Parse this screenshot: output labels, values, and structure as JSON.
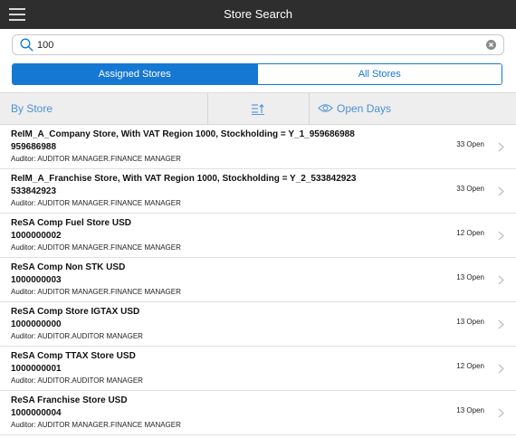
{
  "header": {
    "title": "Store Search",
    "menu_icon": "hamburger-menu-icon"
  },
  "search": {
    "value": "100",
    "placeholder": "",
    "search_icon": "search-icon",
    "clear_icon": "clear-icon"
  },
  "segments": [
    {
      "label": "Assigned Stores",
      "selected": true
    },
    {
      "label": "All Stores",
      "selected": false
    }
  ],
  "sortbar": {
    "by_store": "By Store",
    "sort_icon": "sort-ascending-icon",
    "open_days": "Open Days",
    "open_days_icon": "eye-icon"
  },
  "colors": {
    "accent": "#1578d3",
    "titlebar": "#2e2e2e",
    "sortbar_bg": "#eeeeee",
    "link": "#4a90d9"
  },
  "stores": [
    {
      "name": "ReIM_A_Company Store, With VAT Region 1000, Stockholding = Y_1_959686988",
      "id": "959686988",
      "auditor": "Auditor: AUDITOR  MANAGER.FINANCE  MANAGER",
      "open": "33 Open"
    },
    {
      "name": "ReIM_A_Franchise Store, With VAT Region 1000, Stockholding = Y_2_533842923",
      "id": "533842923",
      "auditor": "Auditor: AUDITOR  MANAGER.FINANCE  MANAGER",
      "open": "33 Open"
    },
    {
      "name": "ReSA Comp Fuel Store USD",
      "id": "1000000002",
      "auditor": "Auditor: AUDITOR  MANAGER.FINANCE  MANAGER",
      "open": "12 Open"
    },
    {
      "name": "ReSA Comp Non STK USD",
      "id": "1000000003",
      "auditor": "Auditor: AUDITOR  MANAGER.FINANCE  MANAGER",
      "open": "13 Open"
    },
    {
      "name": "ReSA Comp Store IGTAX USD",
      "id": "1000000000",
      "auditor": "Auditor: AUDITOR.AUDITOR  MANAGER",
      "open": "13 Open"
    },
    {
      "name": "ReSA Comp TTAX Store USD",
      "id": "1000000001",
      "auditor": "Auditor: AUDITOR.AUDITOR  MANAGER",
      "open": "12 Open"
    },
    {
      "name": "ReSA Franchise Store USD",
      "id": "1000000004",
      "auditor": "Auditor: AUDITOR  MANAGER.FINANCE  MANAGER",
      "open": "13 Open"
    }
  ]
}
